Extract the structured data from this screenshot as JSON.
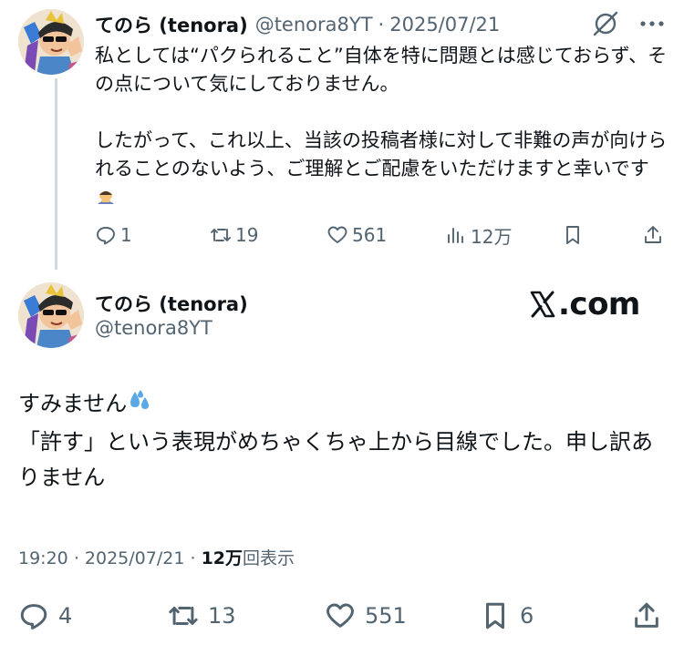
{
  "parent_tweet": {
    "display_name": "てのら (tenora)",
    "handle": "@tenora8YT",
    "separator": "·",
    "date": "2025/07/21",
    "body_lines": [
      "私としては“パクられること”自体を特に問題とは感じておらず、その点について気にしておりません。",
      "したがって、これ以上、当該の投稿者様に対して非難の声が向けられることのないよう、ご理解とご配慮をいただけますと幸いです"
    ],
    "body_emoji": "bowing-person",
    "actions": {
      "replies": "1",
      "reposts": "19",
      "likes": "561",
      "views": "12万"
    }
  },
  "main_tweet": {
    "display_name": "てのら (tenora)",
    "handle": "@tenora8YT",
    "watermark": ".com",
    "body_lines": [
      "すみません",
      "「許す」という表現がめちゃくちゃ上から目線でした。申し訳ありません"
    ],
    "body_emoji": "sweat-droplets",
    "time": "19:20",
    "separator": "·",
    "date": "2025/07/21",
    "views_count": "12万",
    "views_label": "回表示",
    "actions": {
      "replies": "4",
      "reposts": "13",
      "likes": "551",
      "bookmarks": "6"
    }
  },
  "colors": {
    "text": "#0f1419",
    "secondary": "#536471",
    "thread_line": "#cfd9de"
  }
}
